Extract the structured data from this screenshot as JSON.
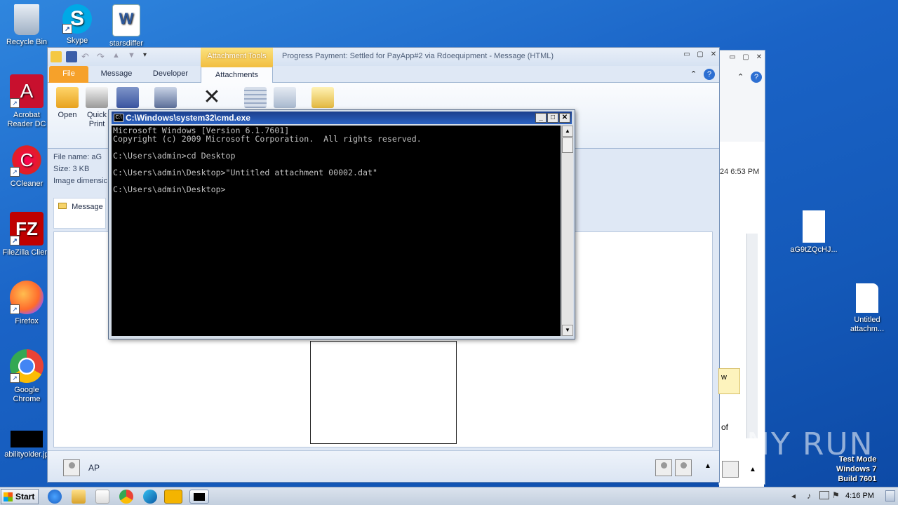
{
  "desktop": {
    "icons": [
      {
        "label": "Recycle Bin"
      },
      {
        "label": "Skype"
      },
      {
        "label": "starsdiffer"
      },
      {
        "label": "Acrobat Reader DC"
      },
      {
        "label": "CCleaner"
      },
      {
        "label": "FileZilla Client"
      },
      {
        "label": "Firefox"
      },
      {
        "label": "Google Chrome"
      },
      {
        "label": "abilityolder.jp"
      },
      {
        "label": "aG9tZQcHJ..."
      },
      {
        "label": "Untitled attachm..."
      }
    ]
  },
  "outlook": {
    "contextual_tab": "Attachment Tools",
    "title": "Progress Payment: Settled for PayApp#2 via Rdoequipment  -  Message (HTML)",
    "tabs": [
      "File",
      "Message",
      "Developer",
      "Attachments"
    ],
    "ribbon": {
      "open": "Open",
      "quick_print_1": "Quick",
      "quick_print_2": "Print"
    },
    "info": {
      "file_name": "File name:   aG",
      "size": "Size:   3 KB",
      "dimensions": "Image dimensic"
    },
    "message_tab": "Message",
    "side_time": "24 6:53 PM",
    "side_text_1": "w",
    "side_text_2": "of",
    "footer_name": "AP"
  },
  "cmd": {
    "title": "C:\\Windows\\system32\\cmd.exe",
    "icon_text": "C:\\",
    "lines": [
      "Microsoft Windows [Version 6.1.7601]",
      "Copyright (c) 2009 Microsoft Corporation.  All rights reserved.",
      "",
      "C:\\Users\\admin>cd Desktop",
      "",
      "C:\\Users\\admin\\Desktop>\"Untitled attachment 00002.dat\"",
      "",
      "C:\\Users\\admin\\Desktop>"
    ]
  },
  "taskbar": {
    "start_label": "Start",
    "time": "4:16 PM"
  },
  "watermark": {
    "line1": "Test Mode",
    "line2": "Windows 7",
    "line3": "Build 7601",
    "brand": "ANY RUN"
  }
}
